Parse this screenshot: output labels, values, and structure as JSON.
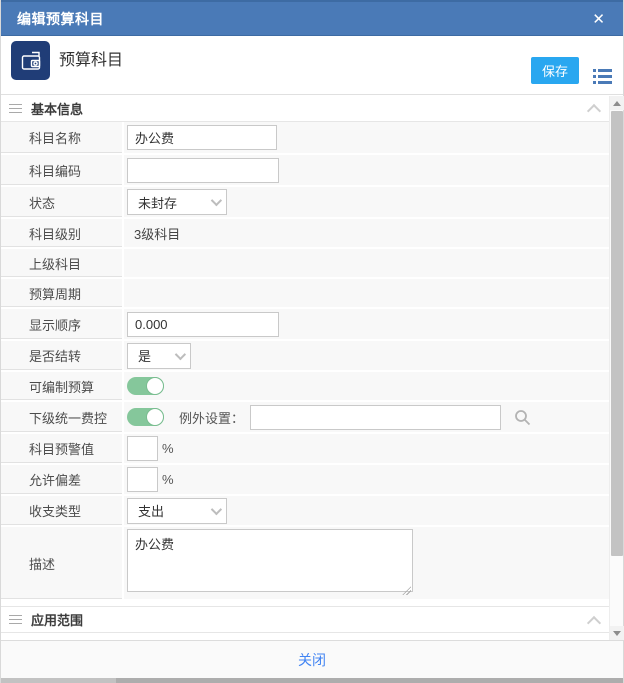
{
  "dialog": {
    "title": "编辑预算科目"
  },
  "header": {
    "title": "预算科目",
    "save": "保存"
  },
  "sections": {
    "basic": "基本信息",
    "scope": "应用范围"
  },
  "fields": {
    "name": {
      "label": "科目名称",
      "value": "办公费"
    },
    "code": {
      "label": "科目编码",
      "value": ""
    },
    "status": {
      "label": "状态",
      "value": "未封存"
    },
    "level": {
      "label": "科目级别",
      "value": "3级科目"
    },
    "parent": {
      "label": "上级科目",
      "value": ""
    },
    "period": {
      "label": "预算周期",
      "value": ""
    },
    "order": {
      "label": "显示顺序",
      "value": "0.000"
    },
    "carryover": {
      "label": "是否结转",
      "value": "是"
    },
    "budgetable": {
      "label": "可编制预算",
      "state": "on"
    },
    "unified": {
      "label": "下级统一费控",
      "state": "on",
      "exception_label": "例外设置：",
      "exception_value": ""
    },
    "warning": {
      "label": "科目预警值",
      "value": "",
      "suffix": "%"
    },
    "deviation": {
      "label": "允许偏差",
      "value": "",
      "suffix": "%"
    },
    "type": {
      "label": "收支类型",
      "value": "支出"
    },
    "desc": {
      "label": "描述",
      "value": "办公费"
    }
  },
  "footer": {
    "close": "关闭"
  },
  "icons": {
    "titlebar_close": "✕",
    "app_icon": "wallet-document-icon",
    "toolbar_list": "list-icon",
    "exception_search": "magnifier-icon"
  },
  "colors": {
    "titlebar_blue": "#4a7ab7",
    "save_button_blue": "#29a7f0",
    "app_icon_navy": "#203d77",
    "toggle_green": "#85c79b",
    "close_link_blue": "#4184f3"
  }
}
